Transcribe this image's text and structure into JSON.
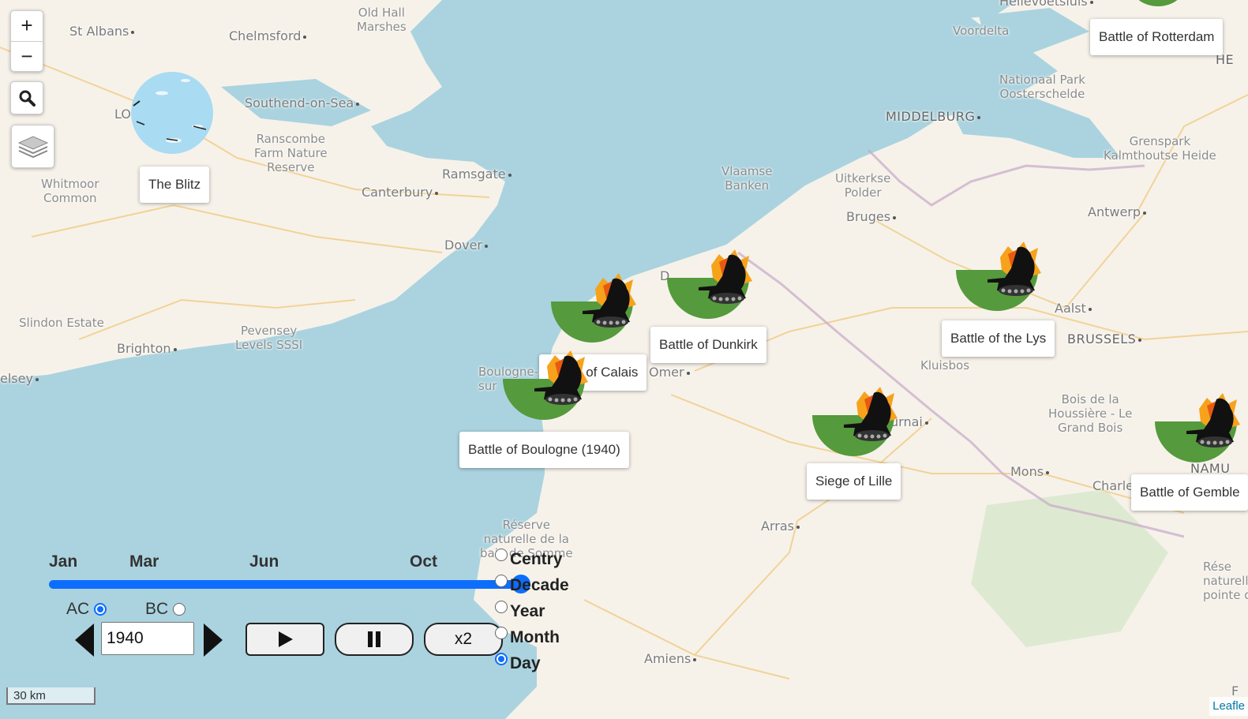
{
  "map": {
    "places": [
      {
        "name": "St Albans"
      },
      {
        "name": "Chelmsford"
      },
      {
        "name": "Old Hall\nMarshes"
      },
      {
        "name": "Southend-on-Sea"
      },
      {
        "name": "LO"
      },
      {
        "name": "Ranscombe\nFarm Nature\nReserve"
      },
      {
        "name": "Whitmoor\nCommon"
      },
      {
        "name": "Ramsgate"
      },
      {
        "name": "Canterbury"
      },
      {
        "name": "Dover"
      },
      {
        "name": "Slindon Estate"
      },
      {
        "name": "Pevensey\nLevels SSSI"
      },
      {
        "name": "Brighton"
      },
      {
        "name": "elsey"
      },
      {
        "name": "Voordelta"
      },
      {
        "name": "Hellevoetsluis"
      },
      {
        "name": "Nationaal Park\nOosterschelde"
      },
      {
        "name": "MIDDELBURG"
      },
      {
        "name": "Grenspark\nKalmthoutse Heide"
      },
      {
        "name": "Vlaamse\nBanken"
      },
      {
        "name": "Uitkerkse\nPolder"
      },
      {
        "name": "Bruges"
      },
      {
        "name": "Antwerp"
      },
      {
        "name": "Aalst"
      },
      {
        "name": "BRUSSELS"
      },
      {
        "name": "Kluisbos"
      },
      {
        "name": "Bois de la\nHoussière - Le\nGrand Bois"
      },
      {
        "name": "Omer"
      },
      {
        "name": "Boulogne-\nsur"
      },
      {
        "name": "urnai"
      },
      {
        "name": "Mons"
      },
      {
        "name": "Charle"
      },
      {
        "name": "NAMU"
      },
      {
        "name": "Réserve\nnaturelle de la\nbaie de Somme"
      },
      {
        "name": "Arras"
      },
      {
        "name": "Amiens"
      },
      {
        "name": "Rése\nnaturelle\npointe de"
      },
      {
        "name": "HE"
      },
      {
        "name": "D"
      },
      {
        "name": "F"
      }
    ],
    "events": [
      {
        "name": "The Blitz",
        "icon": "blitz-aircraft-icon"
      },
      {
        "name": "Battle of Rotterdam",
        "icon": "battle-tank-icon"
      },
      {
        "name": "Siege of Calais",
        "icon": "battle-tank-icon"
      },
      {
        "name": "Battle of Dunkirk",
        "icon": "battle-tank-icon"
      },
      {
        "name": "Battle of the Lys",
        "icon": "battle-tank-icon"
      },
      {
        "name": "Battle of Boulogne (1940)",
        "icon": "battle-tank-icon"
      },
      {
        "name": "Siege of Lille",
        "icon": "battle-tank-icon"
      },
      {
        "name": "Battle of Gemble",
        "icon": "battle-tank-icon"
      }
    ],
    "colors": {
      "sea": "#aad3df",
      "land": "#f6f2ea",
      "battle": "#559a3c",
      "blitz": "#a9dbf3",
      "accent": "#0d6efd"
    }
  },
  "controls": {
    "zoom_in": "+",
    "zoom_out": "−",
    "search_icon": "search-icon",
    "layers_icon": "layers-icon"
  },
  "timeline": {
    "months": [
      "Jan",
      "Mar",
      "Jun",
      "Oct"
    ],
    "progress": 1.0,
    "era": {
      "ac": "AC",
      "bc": "BC",
      "selected": "AC"
    },
    "year": "1940",
    "speed": "x2",
    "granularity": [
      "Centry",
      "Decade",
      "Year",
      "Month",
      "Day"
    ],
    "granularity_selected": "Day"
  },
  "scale": "30 km",
  "attribution": "Leafle"
}
